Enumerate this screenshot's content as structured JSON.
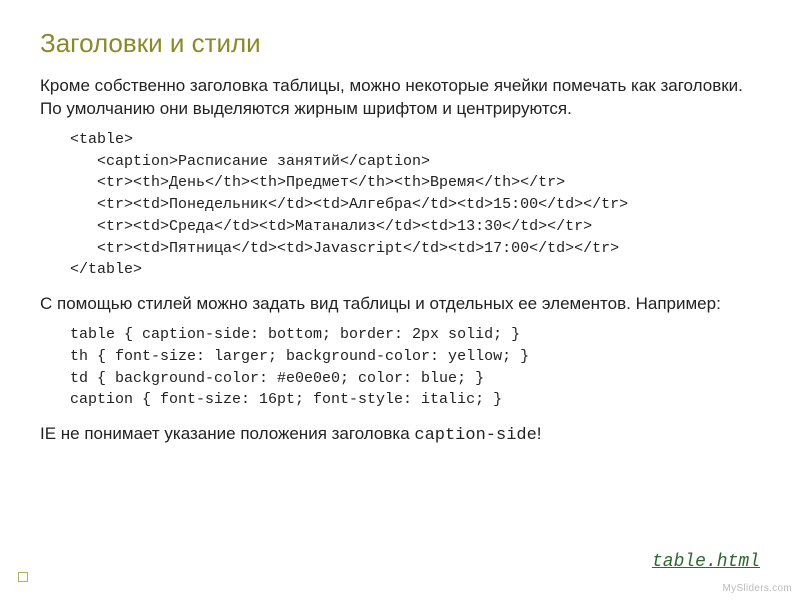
{
  "title": "Заголовки и стили",
  "para1": "Кроме собственно заголовка таблицы, можно некоторые ячейки помечать как заголовки. По умолчанию они выделяются жирным шрифтом и центрируются.",
  "code1": "<table>\n   <caption>Расписание занятий</caption>\n   <tr><th>День</th><th>Предмет</th><th>Время</th></tr>\n   <tr><td>Понедельник</td><td>Алгебра</td><td>15:00</td></tr>\n   <tr><td>Среда</td><td>Матанализ</td><td>13:30</td></tr>\n   <tr><td>Пятница</td><td>Javascript</td><td>17:00</td></tr>\n</table>",
  "para2": "С помощью стилей можно задать вид таблицы и отдельных ее элементов. Например:",
  "code2": "table { caption-side: bottom; border: 2px solid; }\nth { font-size: larger; background-color: yellow; }\ntd { background-color: #e0e0e0; color: blue; }\ncaption { font-size: 16pt; font-style: italic; }",
  "note_prefix": "IE не понимает указание положения заголовка ",
  "note_code": "caption-side",
  "note_suffix": "!",
  "link_text": "table.html",
  "link_href": "#",
  "watermark": "MySliders.com"
}
